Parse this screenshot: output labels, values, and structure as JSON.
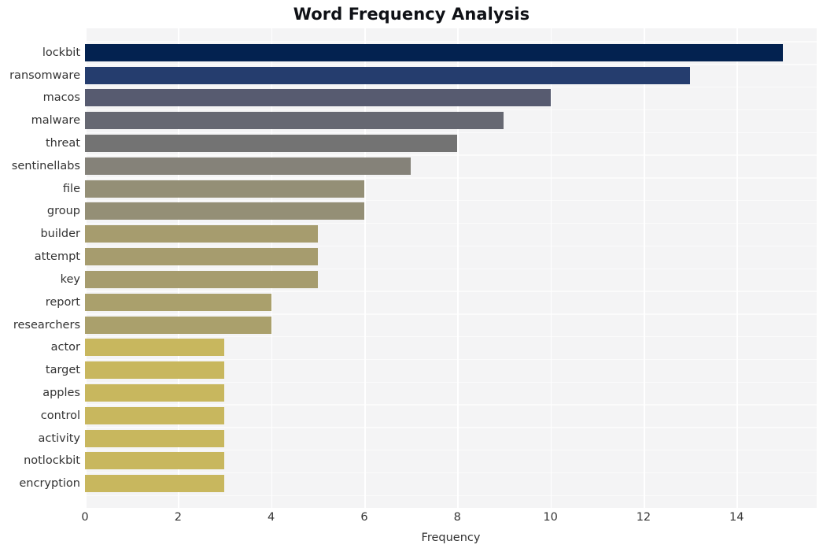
{
  "chart_data": {
    "type": "bar",
    "orientation": "horizontal",
    "title": "Word Frequency Analysis",
    "xlabel": "Frequency",
    "ylabel": "",
    "categories": [
      "lockbit",
      "ransomware",
      "macos",
      "malware",
      "threat",
      "sentinellabs",
      "file",
      "group",
      "builder",
      "attempt",
      "key",
      "report",
      "researchers",
      "actor",
      "target",
      "apples",
      "control",
      "activity",
      "notlockbit",
      "encryption"
    ],
    "values": [
      15,
      13,
      10,
      9,
      8,
      7,
      6,
      6,
      5,
      5,
      5,
      4,
      4,
      3,
      3,
      3,
      3,
      3,
      3,
      3
    ],
    "bar_colors": [
      "#032250",
      "#253d6e",
      "#575b70",
      "#666872",
      "#737373",
      "#858279",
      "#948f76",
      "#948f76",
      "#a69c6e",
      "#a69c6e",
      "#a69c6e",
      "#aaa06c",
      "#aaa06c",
      "#c8b75e",
      "#c8b75e",
      "#c8b75e",
      "#c8b75e",
      "#c8b75e",
      "#c8b75e",
      "#c8b75e"
    ],
    "xticks": [
      0,
      2,
      4,
      6,
      8,
      10,
      12,
      14
    ],
    "xlim": [
      0,
      15.72
    ],
    "grid": true,
    "legend": "none",
    "plot_background": "#f4f4f5",
    "gridline_color": "#ffffff",
    "figure_background": "#ffffff",
    "title_color": "#0f1116",
    "tick_color": "#333333"
  }
}
